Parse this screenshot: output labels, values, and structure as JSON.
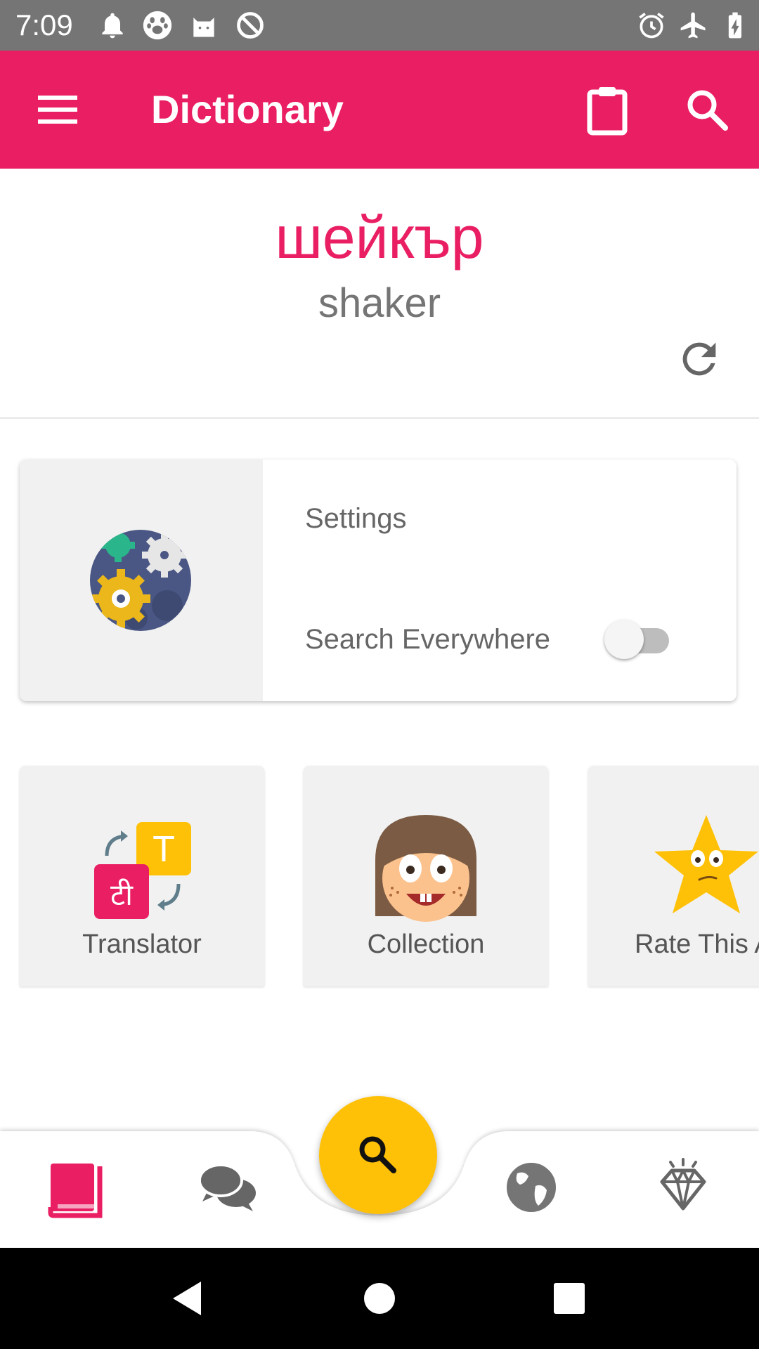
{
  "status_bar": {
    "time": "7:09",
    "left_icons": [
      "bell-icon",
      "paw-icon",
      "cat-icon",
      "no-sync-icon"
    ],
    "right_icons": [
      "alarm-icon",
      "airplane-icon",
      "battery-charging-icon"
    ]
  },
  "app_bar": {
    "title": "Dictionary",
    "icons": [
      "menu-icon",
      "clipboard-icon",
      "search-icon"
    ]
  },
  "word_card": {
    "word": "шейкър",
    "translation": "shaker",
    "refresh_icon": "refresh-icon"
  },
  "settings_card": {
    "title": "Settings",
    "search_everywhere_label": "Search Everywhere",
    "search_everywhere_enabled": false
  },
  "feature_cards": [
    {
      "label": "Translator"
    },
    {
      "label": "Collection"
    },
    {
      "label": "Rate This A"
    }
  ],
  "bottom_nav": {
    "items": [
      "book-icon",
      "chat-icon",
      "globe-icon",
      "diamond-icon"
    ],
    "active": "book-icon",
    "fab_icon": "search-icon"
  },
  "colors": {
    "primary": "#E91E63",
    "accent": "#FFC107",
    "status_bar": "#757575"
  }
}
